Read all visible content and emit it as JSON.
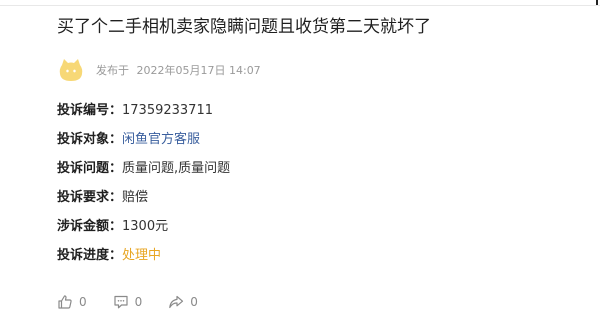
{
  "post": {
    "title": "买了个二手相机卖家隐瞒问题且收货第二天就坏了",
    "published_prefix": "发布于",
    "published_at": "2022年05月17日 14:07"
  },
  "fields": [
    {
      "label": "投诉编号：",
      "value": "17359233711"
    },
    {
      "label": "投诉对象：",
      "value": "闲鱼官方客服"
    },
    {
      "label": "投诉问题：",
      "value": "质量问题,质量问题"
    },
    {
      "label": "投诉要求：",
      "value": "赔偿"
    },
    {
      "label": "涉诉金额：",
      "value": "1300元"
    },
    {
      "label": "投诉进度：",
      "value": "处理中"
    }
  ],
  "actions": {
    "like": {
      "icon": "thumbs-up-icon",
      "count": "0"
    },
    "comment": {
      "icon": "comment-icon",
      "count": "0"
    },
    "share": {
      "icon": "share-icon",
      "count": "0"
    }
  },
  "colors": {
    "link": "#3a5f9e",
    "status": "#e8a623",
    "avatar": "#f7d876",
    "meta": "#9a9a9a"
  }
}
